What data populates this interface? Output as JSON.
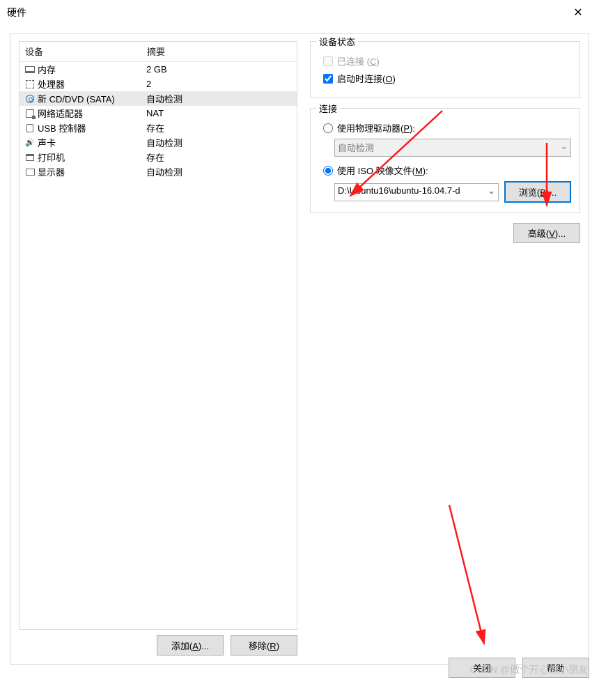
{
  "window": {
    "title": "硬件"
  },
  "devlist": {
    "headers": {
      "device": "设备",
      "summary": "摘要"
    },
    "items": [
      {
        "name": "内存",
        "summary": "2 GB",
        "icon": "memory-icon"
      },
      {
        "name": "处理器",
        "summary": "2",
        "icon": "cpu-icon"
      },
      {
        "name": "新 CD/DVD (SATA)",
        "summary": "自动检测",
        "icon": "cd-icon",
        "selected": true
      },
      {
        "name": "网络适配器",
        "summary": "NAT",
        "icon": "network-icon"
      },
      {
        "name": "USB 控制器",
        "summary": "存在",
        "icon": "usb-icon"
      },
      {
        "name": "声卡",
        "summary": "自动检测",
        "icon": "sound-icon"
      },
      {
        "name": "打印机",
        "summary": "存在",
        "icon": "printer-icon"
      },
      {
        "name": "显示器",
        "summary": "自动检测",
        "icon": "display-icon"
      }
    ]
  },
  "buttons": {
    "add": "添加(A)...",
    "remove": "移除(R)",
    "browse": "浏览(B)...",
    "advanced": "高级(V)...",
    "close": "关闭",
    "help": "帮助"
  },
  "status_group": {
    "legend": "设备状态",
    "connected_label": "已连接 (C)",
    "connect_at_poweron_label": "启动时连接(O)"
  },
  "connect_group": {
    "legend": "连接",
    "use_physical_label": "使用物理驱动器(P):",
    "physical_value": "自动检测",
    "use_iso_label": "使用 ISO 映像文件(M):",
    "iso_path": "D:\\Ubuntu16\\ubuntu-16.04.7-d"
  },
  "watermark": "CSDN @做个开心的小朋友"
}
